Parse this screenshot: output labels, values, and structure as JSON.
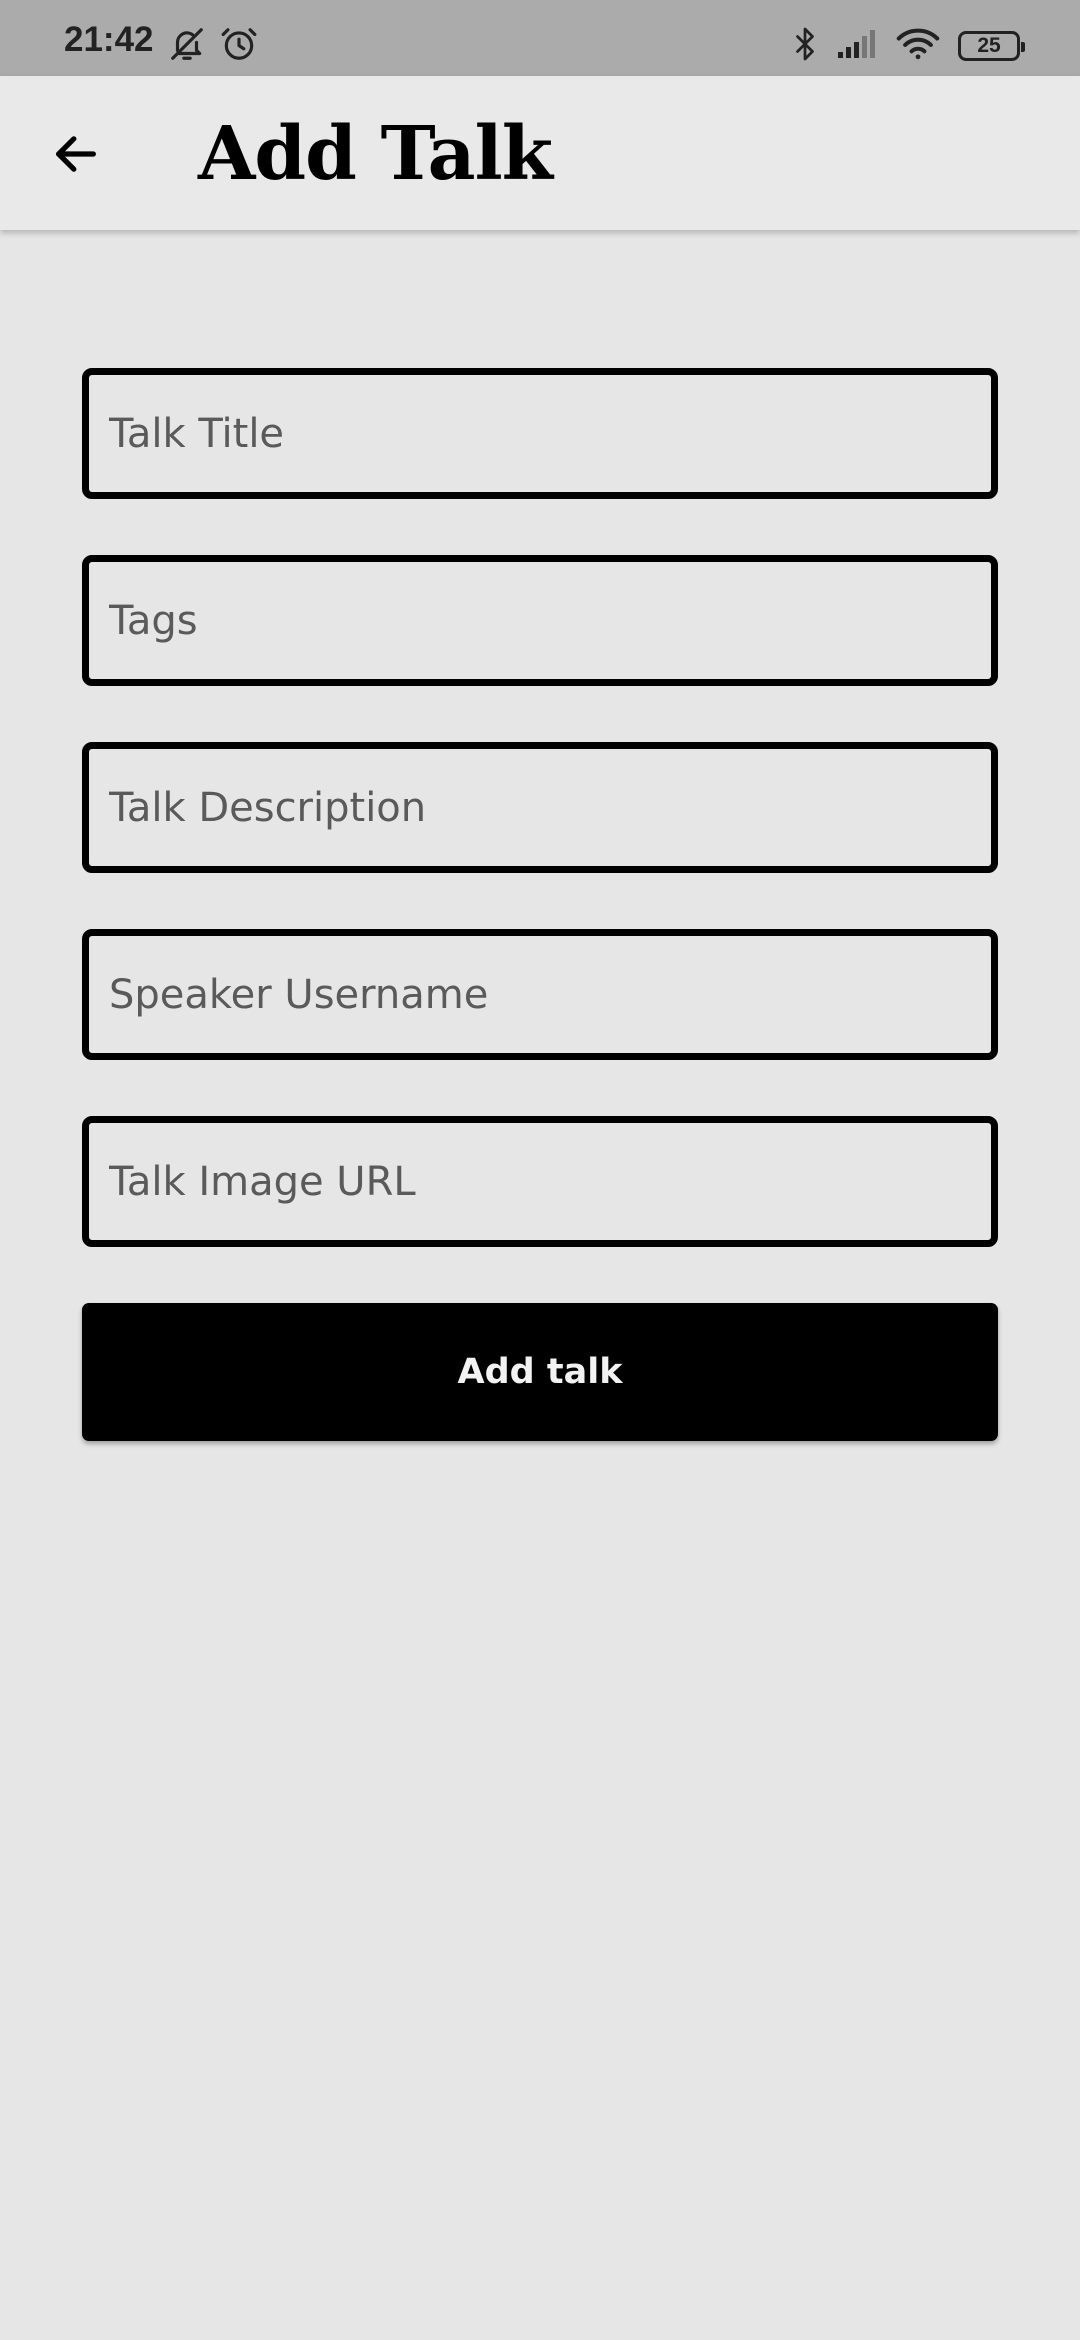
{
  "status_bar": {
    "time": "21:42",
    "battery_level": "25",
    "left_icons": [
      "bell-off-icon",
      "alarm-icon"
    ],
    "right_icons": [
      "bluetooth-icon",
      "signal-icon",
      "wifi-icon",
      "battery-icon"
    ]
  },
  "app_bar": {
    "title": "Add Talk",
    "back_icon": "arrow-left-icon"
  },
  "form": {
    "fields": [
      {
        "placeholder": "Talk Title",
        "value": ""
      },
      {
        "placeholder": "Tags",
        "value": ""
      },
      {
        "placeholder": "Talk Description",
        "value": ""
      },
      {
        "placeholder": "Speaker Username",
        "value": ""
      },
      {
        "placeholder": "Talk Image URL",
        "value": ""
      }
    ],
    "submit_label": "Add talk"
  },
  "colors": {
    "background": "#e6e6e6",
    "app_bar": "#e9e9e9",
    "status_bar": "#ababab",
    "field_border": "#000000",
    "button": "#000000",
    "button_text": "#f2f2f2"
  }
}
